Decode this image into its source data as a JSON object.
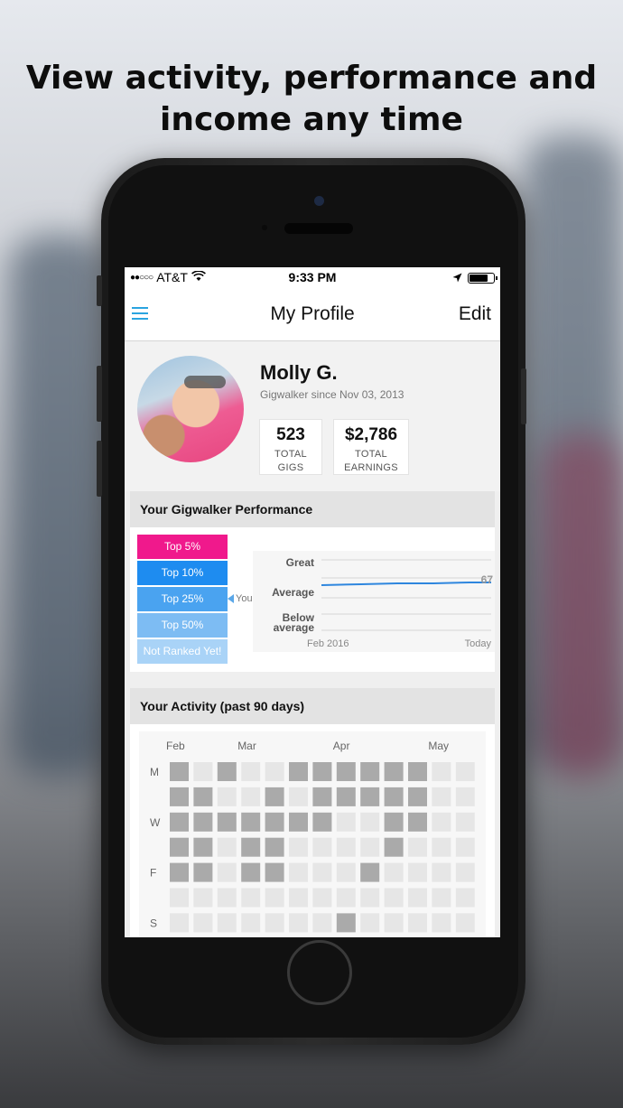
{
  "headline": {
    "line1": "View activity, performance and",
    "line2": "income any time"
  },
  "status_bar": {
    "carrier": "AT&T",
    "signal_dots": "●●○○○",
    "time": "9:33 PM",
    "battery_level": 0.75
  },
  "nav": {
    "title": "My Profile",
    "edit_label": "Edit",
    "menu_icon": "hamburger-icon"
  },
  "profile": {
    "name": "Molly G.",
    "since": "Gigwalker since Nov 03, 2013",
    "stats": [
      {
        "value": "523",
        "label1": "TOTAL",
        "label2": "GIGS"
      },
      {
        "value": "$2,786",
        "label1": "TOTAL",
        "label2": "EARNINGS"
      }
    ]
  },
  "performance": {
    "heading": "Your Gigwalker Performance",
    "ranks": [
      {
        "label": "Top 5%",
        "color": "#f0198c"
      },
      {
        "label": "Top 10%",
        "color": "#1e8cf0"
      },
      {
        "label": "Top 25%",
        "color": "#4aa3f0"
      },
      {
        "label": "Top 50%",
        "color": "#7dbcf3"
      },
      {
        "label": "Not Ranked Yet!",
        "color": "#a9d3f7"
      }
    ],
    "you_label": "You!",
    "you_rank_index": 2,
    "chart": {
      "y_labels": [
        "Great",
        "Average",
        "Below",
        "average"
      ],
      "x_start": "Feb 2016",
      "x_end": "Today",
      "score_label": "67",
      "line_color": "#2e86de"
    }
  },
  "activity": {
    "heading": "Your Activity (past 90 days)",
    "months": [
      "Feb",
      "Mar",
      "Apr",
      "May"
    ],
    "day_labels": [
      "M",
      "",
      "W",
      "",
      "F",
      "",
      "S"
    ],
    "grid": [
      [
        2,
        0,
        2,
        0,
        0,
        2,
        2,
        2,
        2,
        2,
        2,
        0,
        0
      ],
      [
        2,
        2,
        0,
        0,
        2,
        0,
        2,
        2,
        2,
        2,
        2,
        0,
        0
      ],
      [
        2,
        2,
        2,
        2,
        2,
        2,
        2,
        0,
        0,
        2,
        2,
        0,
        0
      ],
      [
        2,
        2,
        0,
        2,
        2,
        0,
        0,
        0,
        0,
        2,
        0,
        0,
        0
      ],
      [
        2,
        2,
        0,
        2,
        2,
        0,
        0,
        0,
        2,
        0,
        0,
        0,
        0
      ],
      [
        0,
        0,
        0,
        0,
        0,
        0,
        0,
        0,
        0,
        0,
        0,
        0,
        0
      ],
      [
        0,
        0,
        0,
        0,
        0,
        0,
        0,
        2,
        0,
        0,
        0,
        0,
        0
      ]
    ],
    "cell_color_active": "#aaaaaa",
    "cell_color_empty": "#e6e6e6"
  }
}
